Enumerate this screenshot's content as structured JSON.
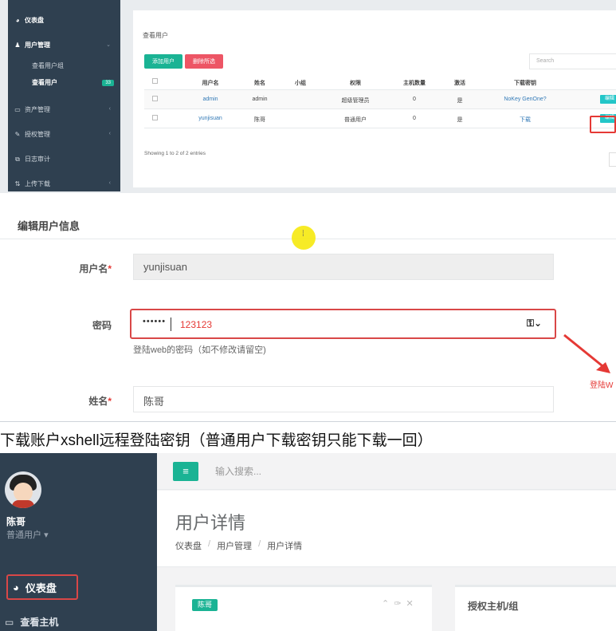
{
  "admin_panel": {
    "sidebar": {
      "dashboard": "仪表盘",
      "user_mgmt": "用户管理",
      "sub_view_groups": "查看用户组",
      "sub_view_users": "查看用户",
      "badge": "33",
      "asset_mgmt": "资产管理",
      "auth_mgmt": "授权管理",
      "audit_log": "日志审计",
      "upload_download": "上传下载"
    },
    "title": "查看用户",
    "add_button": "添加用户",
    "delete_button": "删除所选",
    "search_placeholder": "Search",
    "columns": [
      "用户名",
      "姓名",
      "小组",
      "权限",
      "主机数量",
      "激活",
      "下载密钥"
    ],
    "rows": [
      {
        "username": "admin",
        "name": "admin",
        "group": "",
        "role": "超级管理员",
        "hosts": "0",
        "active": "是",
        "key": "NoKey GenOne?",
        "action": "编辑"
      },
      {
        "username": "yunjisuan",
        "name": "陈哥",
        "group": "",
        "role": "普通用户",
        "hosts": "0",
        "active": "是",
        "key": "下载",
        "action": "编辑"
      }
    ],
    "footer": "Showing 1 to 2 of 2 entries"
  },
  "edit_form": {
    "title": "编辑用户信息",
    "username_label": "用户名",
    "username_value": "yunjisuan",
    "password_label": "密码",
    "password_mask": "••••••",
    "password_typed": "123123",
    "password_help": "登陆web的密码（如不修改请留空)",
    "name_label": "姓名",
    "name_value": "陈哥",
    "annotation": "登陆W",
    "required_mark": "*"
  },
  "caption": "下载账户xshell远程登陆密钥（普通用户下载密钥只能下载一回）",
  "user_detail": {
    "user_name": "陈哥",
    "user_role": "普通用户",
    "sidebar_dashboard": "仪表盘",
    "sidebar_view_hosts": "查看主机",
    "search_placeholder": "输入搜索...",
    "page_title": "用户详情",
    "breadcrumb": [
      "仪表盘",
      "用户管理",
      "用户详情"
    ],
    "card_tag": "陈哥",
    "auth_title": "授权主机/组"
  },
  "colors": {
    "sidebar": "#2f4050",
    "primary": "#1ab394",
    "danger": "#ed5565",
    "highlight": "#d94747"
  }
}
